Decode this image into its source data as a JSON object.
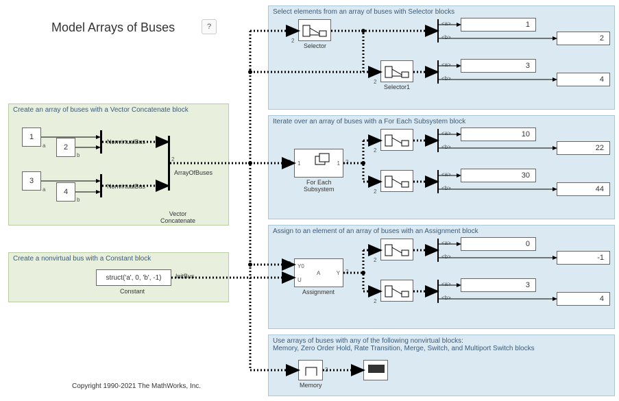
{
  "title": "Model Arrays of Buses",
  "help": "?",
  "copyright": "Copyright 1990-2021 The MathWorks, Inc.",
  "regions": {
    "create_array": "Create an array of buses with a Vector Concatenate block",
    "create_nonvirtual": "Create a nonvirtual bus with a Constant block",
    "select": "Select elements from an array of buses with Selector blocks",
    "iterate": "Iterate over an array of buses with a For Each Subsystem block",
    "assign": "Assign to an element of an array of buses with an Assignment block",
    "nonvirtual": "Use arrays of buses with any of the following nonvirtual blocks:\nMemory, Zero Order Hold, Rate Transition, Merge, Switch, and Multiport Switch blocks"
  },
  "consts": {
    "c1": "1",
    "c2": "2",
    "c3": "3",
    "c4": "4",
    "struct": "struct('a', 0, 'b', -1)"
  },
  "labels": {
    "nonvirtual_bus": "NonvirtualBus",
    "array_of_buses": "ArrayOfBuses",
    "vector_concat": "Vector\nConcatenate",
    "constant": "Constant",
    "init_bus": "InitBus",
    "selector": "Selector",
    "selector1": "Selector1",
    "foreach": "For Each\nSubsystem",
    "assignment": "Assignment",
    "memory": "Memory",
    "a": "a",
    "b": "b",
    "two": "2",
    "one": "1",
    "y0": "Y0",
    "u": "U",
    "y": "Y",
    "A": "A",
    "sela": "<a>",
    "selb": "<b>"
  },
  "displays": {
    "sel_a1": "1",
    "sel_b1": "2",
    "sel_a2": "3",
    "sel_b2": "4",
    "it_a1": "10",
    "it_b1": "22",
    "it_a2": "30",
    "it_b2": "44",
    "as_a1": "0",
    "as_b1": "-1",
    "as_a2": "3",
    "as_b2": "4"
  }
}
